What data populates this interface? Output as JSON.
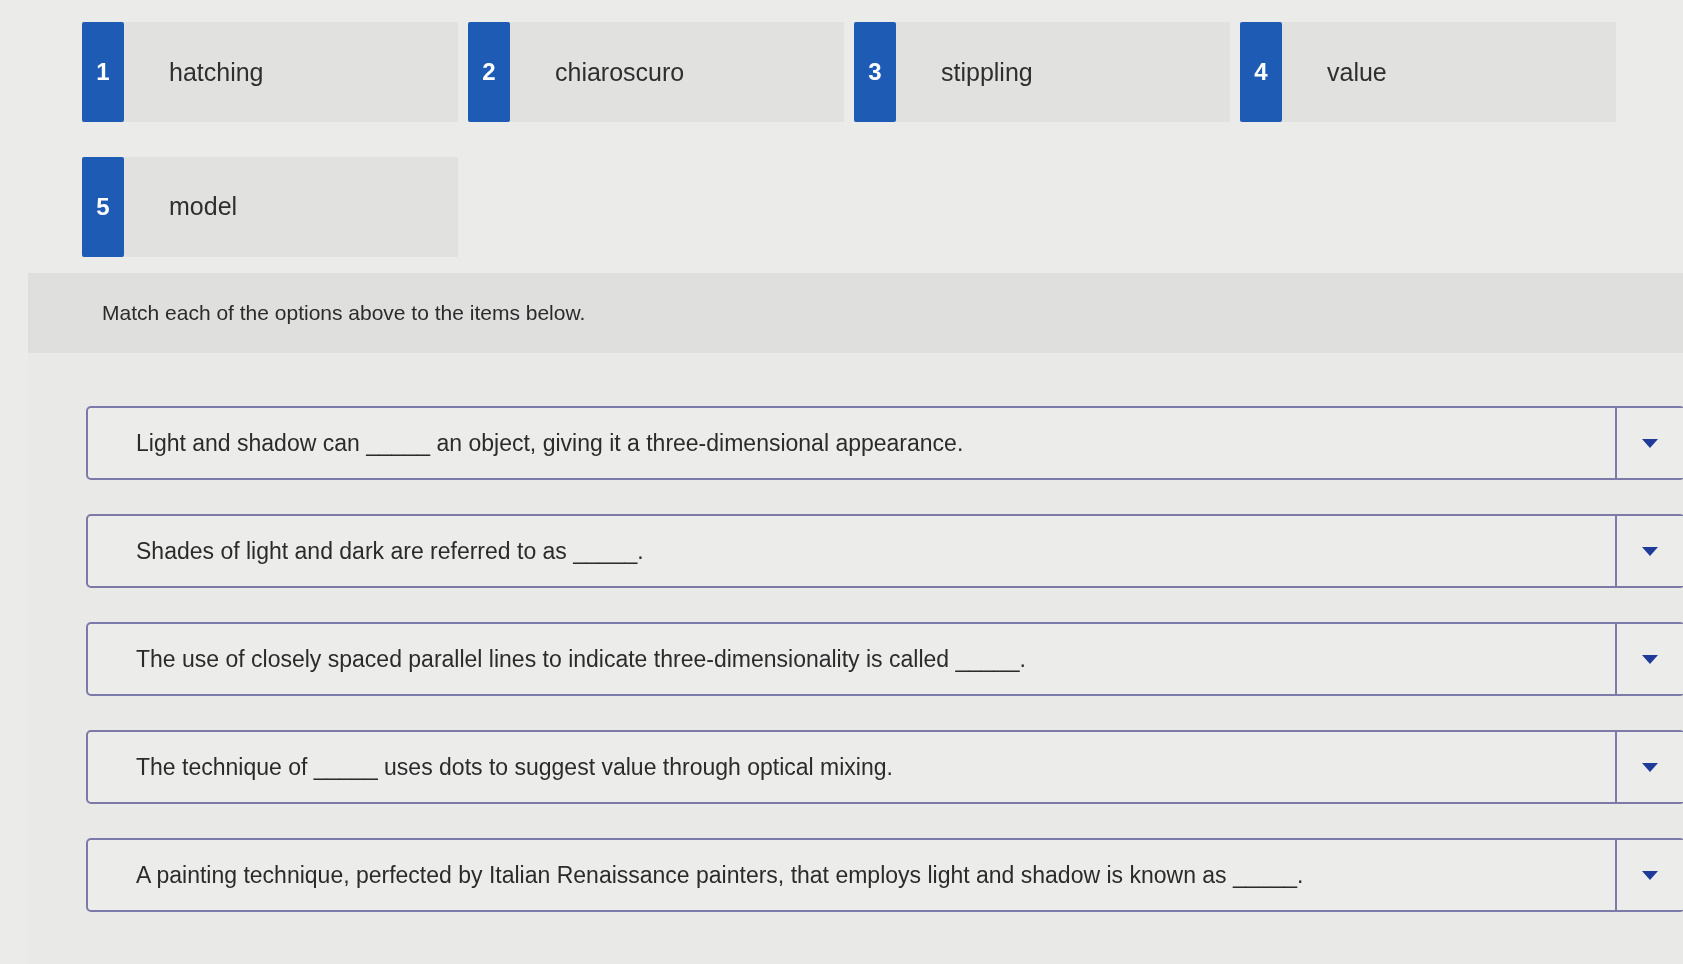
{
  "options": [
    {
      "number": "1",
      "label": "hatching"
    },
    {
      "number": "2",
      "label": "chiaroscuro"
    },
    {
      "number": "3",
      "label": "stippling"
    },
    {
      "number": "4",
      "label": "value"
    },
    {
      "number": "5",
      "label": "model"
    }
  ],
  "instructions": "Match each of the options above to the items below.",
  "items": [
    {
      "prompt": "Light and shadow can _____ an object, giving it a three-dimensional appearance."
    },
    {
      "prompt": "Shades of light and dark are referred to as _____."
    },
    {
      "prompt": "The use of closely spaced parallel lines to indicate three-dimensionality is called _____."
    },
    {
      "prompt": "The technique of _____ uses dots to suggest value through optical mixing."
    },
    {
      "prompt": "A painting technique, perfected by Italian Renaissance painters, that employs light and shadow is known as _____."
    }
  ]
}
